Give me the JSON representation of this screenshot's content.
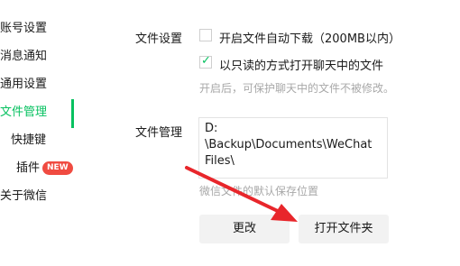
{
  "sidebar": {
    "items": [
      {
        "label": "账号设置"
      },
      {
        "label": "消息通知"
      },
      {
        "label": "通用设置"
      },
      {
        "label": "文件管理"
      },
      {
        "label": "快捷键"
      },
      {
        "label": "插件"
      },
      {
        "label": "关于微信"
      }
    ],
    "new_badge": "NEW"
  },
  "file_settings": {
    "label": "文件设置",
    "auto_download_label": "开启文件自动下载（200MB以内）",
    "auto_download_checked": false,
    "readonly_label": "以只读的方式打开聊天中的文件",
    "readonly_checked": true,
    "readonly_hint": "开启后，可保护聊天中的文件不被修改。"
  },
  "file_management": {
    "label": "文件管理",
    "path": "D:\n\\Backup\\Documents\\WeChat Files\\",
    "path_hint": "微信文件的默认保存位置",
    "change_button": "更改",
    "open_folder_button": "打开文件夹"
  },
  "colors": {
    "accent": "#07c160",
    "badge": "#f04b41",
    "annotation_arrow": "#e8262b"
  }
}
